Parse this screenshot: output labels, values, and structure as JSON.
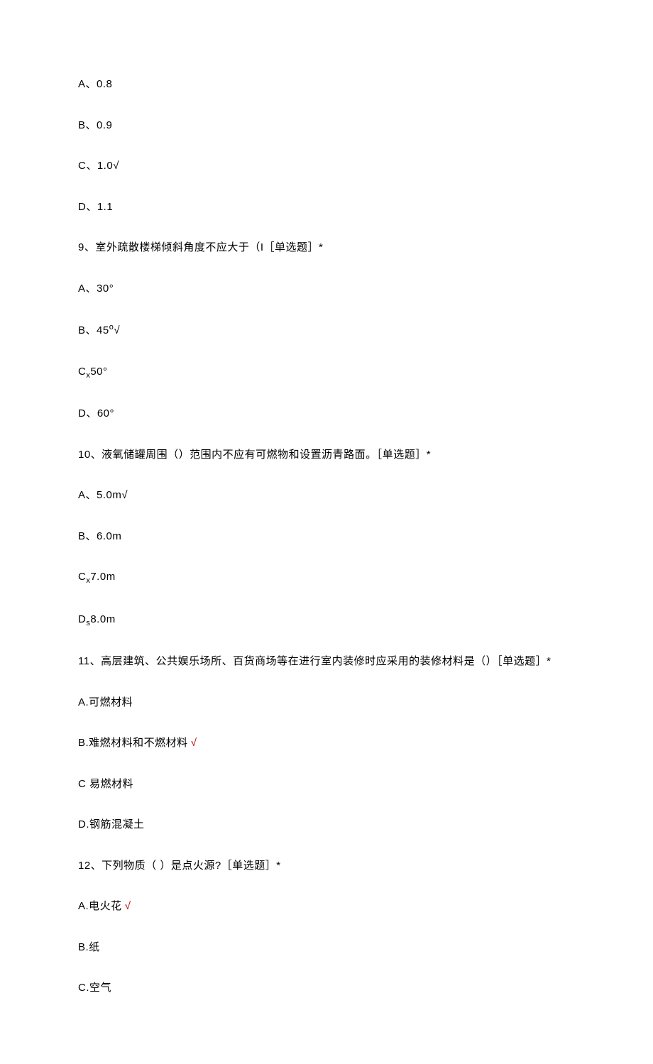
{
  "q8": {
    "options": {
      "a": "A、0.8",
      "b": "B、0.9",
      "c_prefix": "C、",
      "c_value": "1.0",
      "c_mark": "√",
      "d": "D、1.1"
    }
  },
  "q9": {
    "text": "9、室外疏散楼梯倾斜角度不应大于（I［单选题］*",
    "options": {
      "a": "A、30°",
      "b_prefix": "B、45",
      "b_sup": "o",
      "b_mark": "√",
      "c_prefix": "C",
      "c_sub": "x",
      "c_value": "50°",
      "d": "D、60°"
    }
  },
  "q10": {
    "text": "10、液氧储罐周围（）范围内不应有可燃物和设置沥青路面。［单选题］*",
    "options": {
      "a_prefix": "A、",
      "a_value": "5.0m",
      "a_mark": "√",
      "b": "B、6.0m",
      "c_prefix": "C",
      "c_sub": "x",
      "c_value": "7.0m",
      "d_prefix": "D",
      "d_sub": "s",
      "d_value": "8.0m"
    }
  },
  "q11": {
    "text": "11、高层建筑、公共娱乐场所、百货商场等在进行室内装修时应采用的装修材料是（）［单选题］*",
    "options": {
      "a": "A.可燃材料",
      "b_text": "B.难燃材料和不燃材料",
      "b_mark": "√",
      "c": "C 易燃材料",
      "d": "D.钢筋混凝土"
    }
  },
  "q12": {
    "text": "12、下列物质（ ）是点火源?［单选题］*",
    "options": {
      "a_text": "A.电火花",
      "a_mark": "√",
      "b": "B.纸",
      "c": "C.空气"
    }
  }
}
